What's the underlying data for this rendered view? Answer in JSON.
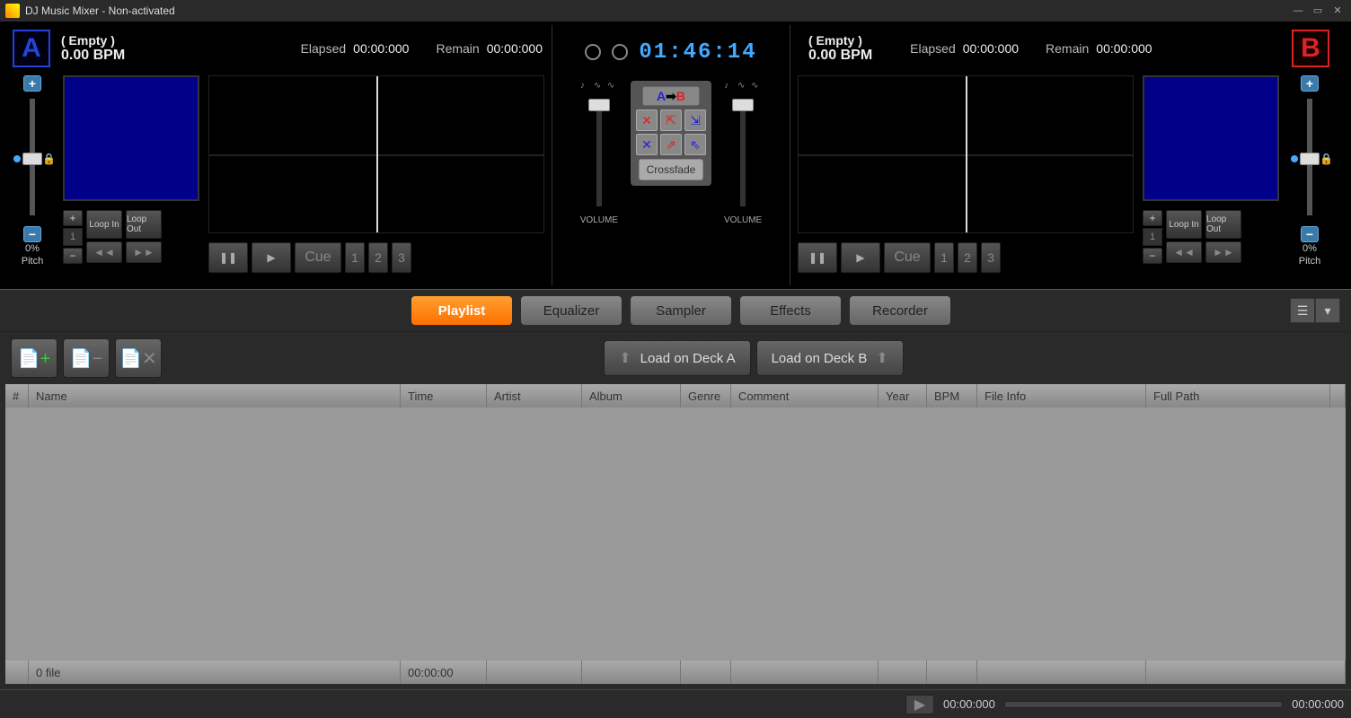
{
  "titlebar": {
    "title": "DJ Music Mixer - Non-activated"
  },
  "clock": {
    "time": "01:46:14"
  },
  "deckA": {
    "letter": "A",
    "title": "( Empty )",
    "bpm": "0.00 BPM",
    "elapsed_label": "Elapsed",
    "elapsed": "00:00:000",
    "remain_label": "Remain",
    "remain": "00:00:000",
    "pitch_pct": "0%",
    "pitch_label": "Pitch",
    "loop_in": "Loop In",
    "loop_out": "Loop Out",
    "cue": "Cue",
    "stepper_val": "1"
  },
  "deckB": {
    "letter": "B",
    "title": "( Empty )",
    "bpm": "0.00 BPM",
    "elapsed_label": "Elapsed",
    "elapsed": "00:00:000",
    "remain_label": "Remain",
    "remain": "00:00:000",
    "pitch_pct": "0%",
    "pitch_label": "Pitch",
    "loop_in": "Loop In",
    "loop_out": "Loop Out",
    "cue": "Cue",
    "stepper_val": "1"
  },
  "mixer": {
    "volume_label": "VOLUME",
    "ab_a": "A",
    "ab_b": "B",
    "crossfade": "Crossfade"
  },
  "tabs": {
    "playlist": "Playlist",
    "equalizer": "Equalizer",
    "sampler": "Sampler",
    "effects": "Effects",
    "recorder": "Recorder"
  },
  "toolbar": {
    "load_a": "Load on Deck A",
    "load_b": "Load on Deck B"
  },
  "table": {
    "headers": {
      "num": "#",
      "name": "Name",
      "time": "Time",
      "artist": "Artist",
      "album": "Album",
      "genre": "Genre",
      "comment": "Comment",
      "year": "Year",
      "bpm": "BPM",
      "fileinfo": "File Info",
      "fullpath": "Full Path"
    },
    "footer": {
      "count": "0 file",
      "time": "00:00:00"
    }
  },
  "bottom": {
    "time_start": "00:00:000",
    "time_end": "00:00:000"
  }
}
